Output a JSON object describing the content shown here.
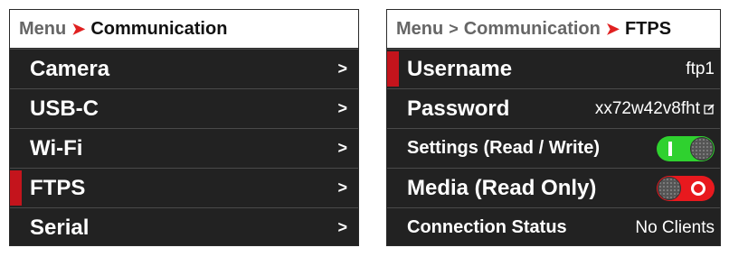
{
  "left_panel": {
    "breadcrumb": {
      "root": "Menu",
      "current": "Communication"
    },
    "items": [
      {
        "label": "Camera",
        "chevron": ">"
      },
      {
        "label": "USB-C",
        "chevron": ">"
      },
      {
        "label": "Wi-Fi",
        "chevron": ">"
      },
      {
        "label": "FTPS",
        "chevron": ">",
        "selected": true
      },
      {
        "label": "Serial",
        "chevron": ">"
      }
    ]
  },
  "right_panel": {
    "breadcrumb": {
      "root": "Menu",
      "middle": "Communication",
      "current": "FTPS"
    },
    "username": {
      "label": "Username",
      "value": "ftp1"
    },
    "password": {
      "label": "Password",
      "value": "xx72w42v8fht"
    },
    "settings": {
      "label": "Settings (Read / Write)",
      "state": "on"
    },
    "media": {
      "label": "Media (Read Only)",
      "state": "off"
    },
    "connection": {
      "label": "Connection Status",
      "value": "No Clients"
    }
  },
  "colors": {
    "accent_red": "#c4141c",
    "toggle_on": "#2fd12f",
    "toggle_off": "#e8191e"
  },
  "icons": {
    "chevron": "chevron-right-icon",
    "edit": "edit-icon"
  }
}
